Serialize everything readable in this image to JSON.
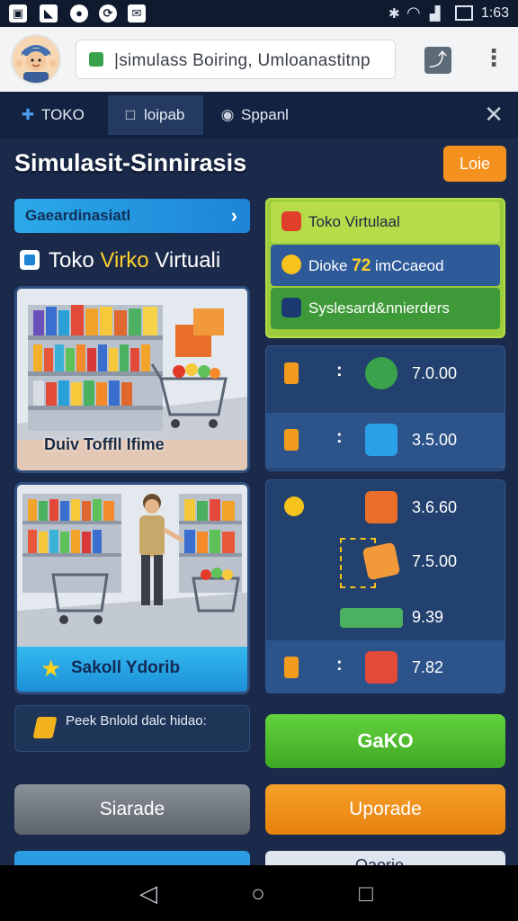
{
  "status_bar": {
    "left_icons": [
      "photo-icon",
      "chart-icon",
      "circle-icon",
      "sync-icon",
      "mail-icon"
    ],
    "time": "1:63"
  },
  "browser": {
    "url": "|simulass Boiring, Umloanastitnp"
  },
  "tabs": [
    {
      "label": "TOKO",
      "icon": "puzzle-icon",
      "active": false
    },
    {
      "label": "loipab",
      "icon": "square-icon",
      "active": true
    },
    {
      "label": "Sppanl",
      "icon": "shield-icon",
      "active": false
    }
  ],
  "header": {
    "title": "Simulasit-Sinnirasis",
    "login_label": "Loie"
  },
  "left": {
    "banner_label": "Gaeardinasiatl",
    "store_heading_part1": "Toko ",
    "store_heading_highlight": "Virko",
    "store_heading_part2": " Virtuali",
    "card1_caption": "Duiv Toffll Ifime",
    "card2_caption": "Sakoll Ydorib",
    "small_card_text": "Peek Bnlold dalc hidao:",
    "gray_button": "Siarade"
  },
  "right": {
    "info": [
      {
        "text": "Toko Virtulaal",
        "icon": "record-icon",
        "color": "#e0402a"
      },
      {
        "text_before": "Dioke ",
        "text_highlight": "72",
        "text_after": " imCcaeod",
        "icon": "check-circle-icon",
        "color": "#f6c21c"
      },
      {
        "text": "Syslesard&nnierders",
        "icon": "check-square-icon",
        "color": "#1b3a72"
      }
    ],
    "stats_a": [
      {
        "value": "7.0.00",
        "thumb": "lollipop-icon"
      },
      {
        "value": "3.5.00",
        "thumb": "browser-window-icon"
      }
    ],
    "stats_b": [
      {
        "value": "3.6.60",
        "thumb": "toy-robot-icon"
      },
      {
        "value": "7.5.00",
        "thumb": "box-character-icon"
      },
      {
        "value": "9.39",
        "thumb": "battery-bars-icon"
      },
      {
        "value": "7.82",
        "thumb": "gift-box-icon"
      }
    ],
    "green_button": "GaKO",
    "orange_button": "Uporade",
    "partial_button": "Oaorie"
  },
  "colors": {
    "background": "#1b2a4a",
    "accent_orange": "#f5911e",
    "accent_green": "#4fbf2f",
    "accent_blue": "#2ba9e9"
  }
}
